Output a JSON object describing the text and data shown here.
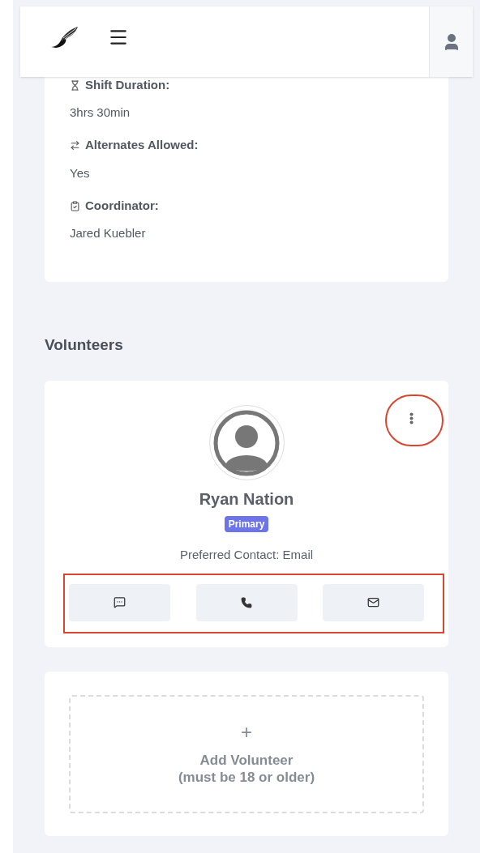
{
  "details": [
    {
      "label": "Shift Duration:",
      "value": "3hrs 30min"
    },
    {
      "label": "Alternates Allowed:",
      "value": "Yes"
    },
    {
      "label": "Coordinator:",
      "value": "Jared Kuebler"
    }
  ],
  "volunteers_heading": "Volunteers",
  "volunteers": [
    {
      "name": "Ryan Nation",
      "badge": "Primary",
      "preferred_contact": "Preferred Contact: Email"
    }
  ],
  "add_volunteer": {
    "symbol": "+",
    "label": "Add Volunteer",
    "note": "(must be 18 or older)"
  }
}
